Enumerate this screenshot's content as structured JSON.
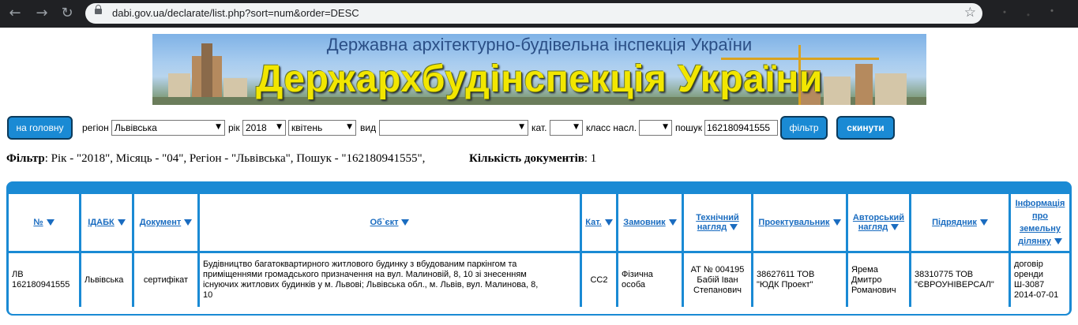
{
  "browser": {
    "url": "dabi.gov.ua/declarate/list.php?sort=num&order=DESC"
  },
  "banner": {
    "subtitle": "Державна архітектурно-будівельна інспекція України",
    "title": "Держархбудінспекція України"
  },
  "filters": {
    "home_button": "на головну",
    "region_label": "регіон",
    "region_value": "Львівська",
    "year_label": "рік",
    "year_value": "2018",
    "month_value": "квітень",
    "type_label": "вид",
    "type_value": "",
    "cat_label": "кат.",
    "cat_value": "",
    "class_label": "класс насл.",
    "class_value": "",
    "search_label": "пошук",
    "search_value": "162180941555",
    "filter_button": "фільтр",
    "reset_button": "скинути"
  },
  "summary": {
    "filter_label": "Фільтр",
    "filter_text": ": Рік - \"2018\", Місяць - \"04\", Регіон - \"Львівська\", Пошук - \"162180941555\",",
    "count_label": "Кількість документів",
    "count_text": ": 1"
  },
  "table": {
    "headers": {
      "num": "№",
      "idabk": "ІДАБК",
      "document": "Документ",
      "object": "Об`єкт",
      "cat": "Кат.",
      "customer_1": "Замовник",
      "supervision_1": "Технічний",
      "supervision_2": "нагляд",
      "designer": "Проектувальник",
      "author_1": "Авторський",
      "author_2": "нагляд",
      "contractor": "Підрядник",
      "land_1": "Інформація",
      "land_2": "про",
      "land_3": "земельну",
      "land_4": "ділянку"
    },
    "row": {
      "num_1": "ЛВ",
      "num_2": "162180941555",
      "idabk": "Львівська",
      "document": "сертифікат",
      "object_1": "Будівництво багатоквартирного житлового будинку з вбудованим паркінгом та",
      "object_2": "приміщеннями громадського призначення на вул. Малиновій, 8, 10 зі знесенням",
      "object_3": "існуючих житлових будинків у м. Львові; Львівська обл., м. Львів, вул. Малинова, 8,",
      "object_4": "10",
      "cat": "СС2",
      "customer_1": "Фізична",
      "customer_2": "особа",
      "supervision_1": "АТ № 004195",
      "supervision_2": "Бабій Іван",
      "supervision_3": "Степанович",
      "designer_1": "38627611 ТОВ",
      "designer_2": "\"ЮДК Проект\"",
      "author_1": "Ярема",
      "author_2": "Дмитро",
      "author_3": "Романович",
      "contractor_1": "38310775 ТОВ",
      "contractor_2": "\"ЄВРОУНІВЕРСАЛ\"",
      "land_1": "договір",
      "land_2": "оренди",
      "land_3": "Ш-3087",
      "land_4": "2014-07-01"
    }
  }
}
